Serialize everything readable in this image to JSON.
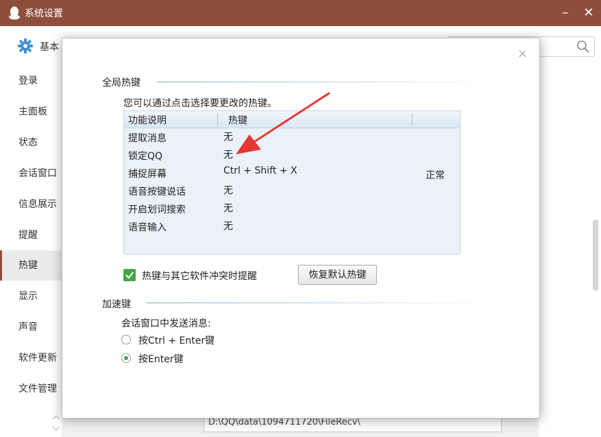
{
  "window": {
    "title": "系统设置",
    "minimize_symbol": "–",
    "close_symbol": "✕",
    "brand_color": "#8d4f3c"
  },
  "toolbar": {
    "top_label": "基本",
    "search_placeholder": ""
  },
  "sidebar": {
    "items": [
      {
        "label": "登录"
      },
      {
        "label": "主面板"
      },
      {
        "label": "状态"
      },
      {
        "label": "会话窗口"
      },
      {
        "label": "信息展示"
      },
      {
        "label": "提醒"
      },
      {
        "label": "热键"
      },
      {
        "label": "显示"
      },
      {
        "label": "声音"
      },
      {
        "label": "软件更新"
      },
      {
        "label": "文件管理"
      }
    ],
    "active_label": "热键"
  },
  "background": {
    "file_path": "D:\\QQ\\data\\1094711720\\FileRecv\\"
  },
  "dialog": {
    "close_symbol": "×",
    "global_hotkeys": {
      "section_title": "全局热键",
      "description": "您可以通过点击选择要更改的热键。",
      "columns": [
        "功能说明",
        "热键",
        ""
      ],
      "rows": [
        {
          "function": "提取消息",
          "hotkey": "无",
          "status": ""
        },
        {
          "function": "锁定QQ",
          "hotkey": "无",
          "status": ""
        },
        {
          "function": "捕捉屏幕",
          "hotkey": "Ctrl + Shift + X",
          "status": "正常"
        },
        {
          "function": "语音按键说话",
          "hotkey": "无",
          "status": ""
        },
        {
          "function": "开启划词搜索",
          "hotkey": "无",
          "status": ""
        },
        {
          "function": "语音输入",
          "hotkey": "无",
          "status": ""
        }
      ],
      "conflict_checkbox_label": "热键与其它软件冲突时提醒",
      "conflict_checked": true,
      "restore_button_label": "恢复默认热键"
    },
    "accelerator": {
      "section_title": "加速键",
      "send_label": "会话窗口中发送消息:",
      "options": [
        {
          "label": "按Ctrl + Enter键",
          "selected": false
        },
        {
          "label": "按Enter键",
          "selected": true
        }
      ]
    },
    "accent_color": "#43a747",
    "annotation_arrow_color": "#e53935"
  }
}
